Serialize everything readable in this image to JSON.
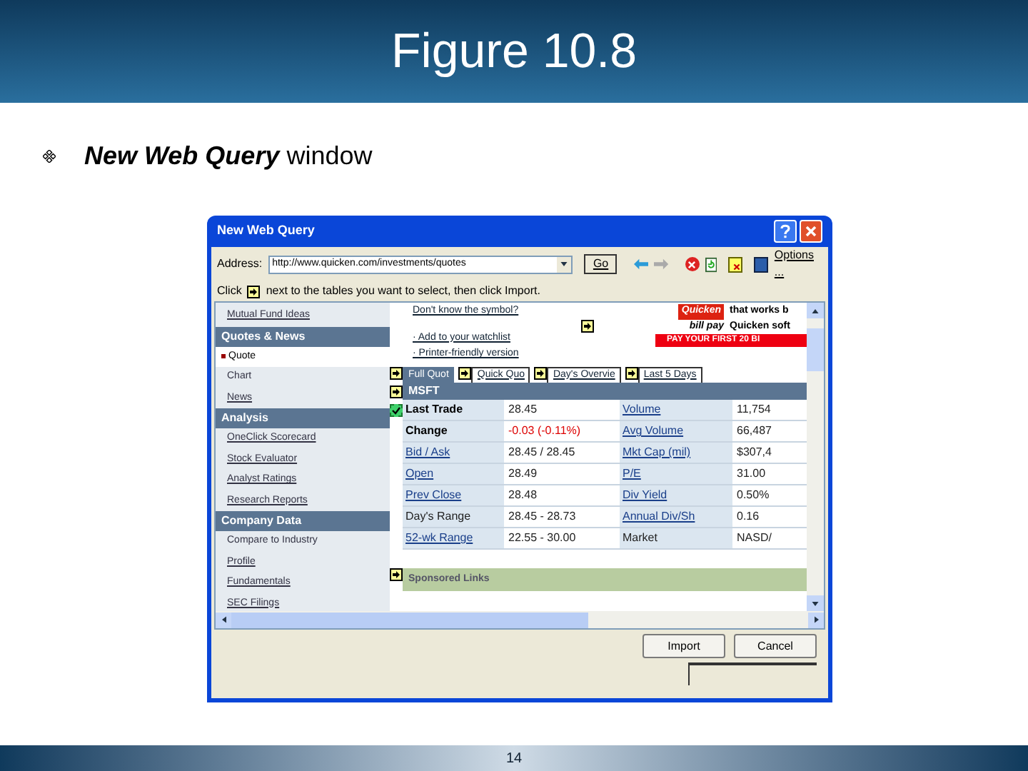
{
  "slide": {
    "title": "Figure 10.8",
    "bullet": {
      "emphasis": "New Web Query",
      "text": "window"
    },
    "page_number": "14"
  },
  "window": {
    "title": "New Web Query",
    "address": {
      "label": "Address:",
      "value": "http://www.quicken.com/investments/quotes",
      "go": "Go",
      "options": "Options ..."
    },
    "instruction": {
      "before": "Click",
      "after": "next to the tables you want to select, then click Import."
    },
    "sidebar": [
      {
        "kind": "link",
        "label": "Mutual Fund Ideas",
        "selected": false
      },
      {
        "kind": "header",
        "label": "Quotes & News"
      },
      {
        "kind": "plain",
        "label": "Quote",
        "selected": true
      },
      {
        "kind": "plain",
        "label": "Chart",
        "selected": false
      },
      {
        "kind": "link",
        "label": "News",
        "selected": false
      },
      {
        "kind": "header",
        "label": "Analysis"
      },
      {
        "kind": "link",
        "label": "OneClick Scorecard",
        "selected": false
      },
      {
        "kind": "link",
        "label": "Stock Evaluator",
        "selected": false
      },
      {
        "kind": "link",
        "label": "Analyst Ratings",
        "selected": false
      },
      {
        "kind": "link",
        "label": "Research Reports",
        "selected": false
      },
      {
        "kind": "header",
        "label": "Company Data"
      },
      {
        "kind": "plain",
        "label": "Compare to Industry",
        "selected": false
      },
      {
        "kind": "link",
        "label": "Profile",
        "selected": false
      },
      {
        "kind": "link",
        "label": "Fundamentals",
        "selected": false
      },
      {
        "kind": "link",
        "label": "SEC Filings",
        "selected": false
      }
    ],
    "links": [
      "Don't know the symbol?",
      "· Add to your watchlist",
      "· Printer-friendly version"
    ],
    "ad": {
      "brand": "Quicken",
      "product": "bill pay",
      "line_1": "that works b",
      "line_2": "Quicken soft",
      "banner": "PAY YOUR FIRST 20 BI"
    },
    "tabs": [
      {
        "label": "Full Quot",
        "selected": true
      },
      {
        "label": "Quick Quo",
        "selected": false
      },
      {
        "label": "Day's Overvie",
        "selected": false
      },
      {
        "label": "Last 5 Days",
        "selected": false
      }
    ],
    "quote_table": {
      "symbol": "MSFT",
      "selected": true,
      "rows": [
        [
          {
            "text": "Last Trade",
            "link": false
          },
          {
            "text": "28.45",
            "kind": "plain"
          },
          {
            "text": "Volume",
            "link": true
          },
          {
            "text": "11,754",
            "kind": "plain"
          }
        ],
        [
          {
            "text": "Change",
            "link": false
          },
          {
            "text": "-0.03 (-0.11%)",
            "kind": "down"
          },
          {
            "text": "Avg Volume",
            "link": true
          },
          {
            "text": "66,487",
            "kind": "plain"
          }
        ],
        [
          {
            "text": "Bid / Ask",
            "link": true
          },
          {
            "text": "28.45 / 28.45",
            "kind": "plain"
          },
          {
            "text": "Mkt Cap (mil)",
            "link": true
          },
          {
            "text": "$307,4",
            "kind": "plain"
          }
        ],
        [
          {
            "text": "Open",
            "link": true
          },
          {
            "text": "28.49",
            "kind": "plain"
          },
          {
            "text": "P/E",
            "link": true
          },
          {
            "text": "31.00",
            "kind": "plain"
          }
        ],
        [
          {
            "text": "Prev Close",
            "link": true
          },
          {
            "text": "28.48",
            "kind": "plain"
          },
          {
            "text": "Div Yield",
            "link": true
          },
          {
            "text": "0.50%",
            "kind": "plain"
          }
        ],
        [
          {
            "text": "Day's Range",
            "link": false
          },
          {
            "text": "28.45 - 28.73",
            "kind": "plain"
          },
          {
            "text": "Annual Div/Sh",
            "link": true
          },
          {
            "text": "0.16",
            "kind": "plain"
          }
        ],
        [
          {
            "text": "52-wk Range",
            "link": true
          },
          {
            "text": "22.55 - 30.00",
            "kind": "plain"
          },
          {
            "text": "Market",
            "link": false
          },
          {
            "text": "NASD/",
            "kind": "plain"
          }
        ]
      ]
    },
    "sponsored": "Sponsored Links",
    "buttons": [
      "Import",
      "Cancel"
    ]
  }
}
